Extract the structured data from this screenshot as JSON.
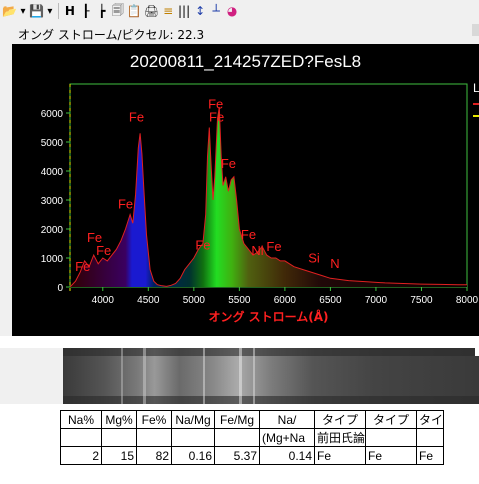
{
  "toolbar": {
    "items": [
      {
        "name": "open-folder-icon",
        "glyph": "📂"
      },
      {
        "name": "open-dropdown-icon",
        "glyph": "▾"
      },
      {
        "name": "save-icon",
        "glyph": "💾"
      },
      {
        "name": "save-dropdown-icon",
        "glyph": "▾"
      },
      {
        "name": "h-marker-icon",
        "glyph": "H"
      },
      {
        "name": "peak-mark-icon",
        "glyph": "┠"
      },
      {
        "name": "line-split-icon",
        "glyph": "┢"
      },
      {
        "name": "copy-icon",
        "glyph": "🗐"
      },
      {
        "name": "paste-icon",
        "glyph": "📋"
      },
      {
        "name": "print-icon",
        "glyph": "🖨"
      },
      {
        "name": "calibrate-icon",
        "glyph": "≡"
      },
      {
        "name": "bars-icon",
        "glyph": "|||"
      },
      {
        "name": "vertical-range-icon",
        "glyph": "↕"
      },
      {
        "name": "baseline-icon",
        "glyph": "┴"
      },
      {
        "name": "color-wheel-icon",
        "glyph": "◕"
      }
    ]
  },
  "ratio_label": "オング ストローム/ピクセル: 22.3",
  "chart_data": {
    "type": "area",
    "title": "20200811_214257ZED?FesL8",
    "xlabel": "オング ストローム(Å)",
    "ylabel": "",
    "xlim": [
      3640,
      8000
    ],
    "ylim": [
      0,
      7000
    ],
    "xticks": [
      4000,
      4500,
      5000,
      5500,
      6000,
      6500,
      7000,
      7500,
      8000
    ],
    "yticks": [
      0,
      1000,
      2000,
      3000,
      4000,
      5000,
      6000
    ],
    "legend_text": "L",
    "colors": {
      "axes": "#3fbf3f",
      "curve": "#e02020",
      "annotation": "#ff2020",
      "fill_blue": "#1a1ad0",
      "fill_green": "#22dd22",
      "tick_text": "#ffffff",
      "xlabel": "#ff2020",
      "marker": "#e8e800"
    },
    "series": [
      {
        "values": [
          [
            3640,
            0
          ],
          [
            3700,
            200
          ],
          [
            3750,
            500
          ],
          [
            3800,
            900
          ],
          [
            3850,
            700
          ],
          [
            3900,
            1100
          ],
          [
            3950,
            800
          ],
          [
            4000,
            1000
          ],
          [
            4050,
            900
          ],
          [
            4100,
            1100
          ],
          [
            4150,
            1300
          ],
          [
            4200,
            1600
          ],
          [
            4250,
            2000
          ],
          [
            4300,
            2500
          ],
          [
            4330,
            2200
          ],
          [
            4360,
            3200
          ],
          [
            4390,
            4800
          ],
          [
            4410,
            5300
          ],
          [
            4430,
            4600
          ],
          [
            4450,
            3400
          ],
          [
            4480,
            1800
          ],
          [
            4520,
            600
          ],
          [
            4560,
            200
          ],
          [
            4600,
            80
          ],
          [
            4650,
            40
          ],
          [
            4700,
            20
          ],
          [
            4750,
            60
          ],
          [
            4800,
            120
          ],
          [
            4850,
            300
          ],
          [
            4900,
            600
          ],
          [
            4950,
            800
          ],
          [
            5000,
            1000
          ],
          [
            5050,
            1300
          ],
          [
            5100,
            1500
          ],
          [
            5130,
            2500
          ],
          [
            5150,
            4500
          ],
          [
            5170,
            5500
          ],
          [
            5190,
            4200
          ],
          [
            5210,
            3000
          ],
          [
            5230,
            3800
          ],
          [
            5260,
            5800
          ],
          [
            5280,
            6200
          ],
          [
            5300,
            4500
          ],
          [
            5320,
            3500
          ],
          [
            5350,
            3800
          ],
          [
            5380,
            3300
          ],
          [
            5410,
            3700
          ],
          [
            5440,
            3800
          ],
          [
            5470,
            3000
          ],
          [
            5500,
            2000
          ],
          [
            5550,
            1500
          ],
          [
            5600,
            1300
          ],
          [
            5650,
            1100
          ],
          [
            5700,
            1200
          ],
          [
            5750,
            1400
          ],
          [
            5800,
            1100
          ],
          [
            5850,
            1000
          ],
          [
            5900,
            1000
          ],
          [
            5950,
            900
          ],
          [
            6000,
            900
          ],
          [
            6100,
            700
          ],
          [
            6200,
            600
          ],
          [
            6300,
            500
          ],
          [
            6400,
            400
          ],
          [
            6500,
            300
          ],
          [
            6700,
            220
          ],
          [
            6900,
            180
          ],
          [
            7100,
            140
          ],
          [
            7300,
            120
          ],
          [
            7500,
            100
          ],
          [
            7700,
            90
          ],
          [
            7900,
            80
          ],
          [
            8000,
            80
          ]
        ]
      }
    ],
    "annotations": [
      {
        "text": "Fe",
        "x": 4370,
        "y": 5700
      },
      {
        "text": "Fe",
        "x": 4250,
        "y": 2700
      },
      {
        "text": "Fe",
        "x": 3910,
        "y": 1550
      },
      {
        "text": "Fe",
        "x": 4010,
        "y": 1100
      },
      {
        "text": "Fe",
        "x": 3780,
        "y": 550
      },
      {
        "text": "Fe",
        "x": 5240,
        "y": 6150
      },
      {
        "text": "Fe",
        "x": 5380,
        "y": 4100
      },
      {
        "text": "Fe",
        "x": 5100,
        "y": 1300
      },
      {
        "text": "Fe",
        "x": 5600,
        "y": 1650
      },
      {
        "text": "Fe",
        "x": 5880,
        "y": 1250
      },
      {
        "text": "Fe",
        "x": 5250,
        "y": 5700
      },
      {
        "text": "Ni",
        "x": 5700,
        "y": 1100
      },
      {
        "text": "Si",
        "x": 6320,
        "y": 850
      },
      {
        "text": "N",
        "x": 6550,
        "y": 650
      }
    ]
  },
  "table": {
    "header1": [
      "Na%",
      "Mg%",
      "Fe%",
      "Na/Mg",
      "Fe/Mg",
      "Na/",
      "タイプ",
      "タイプ",
      "タイプ"
    ],
    "header2": [
      "",
      "",
      "",
      "",
      "",
      "(Mg+Na",
      "前田氏論文",
      "",
      ""
    ],
    "row": [
      "2",
      "15",
      "82",
      "0.16",
      "5.37",
      "0.14",
      "Fe",
      "Fe",
      "Fe"
    ]
  }
}
